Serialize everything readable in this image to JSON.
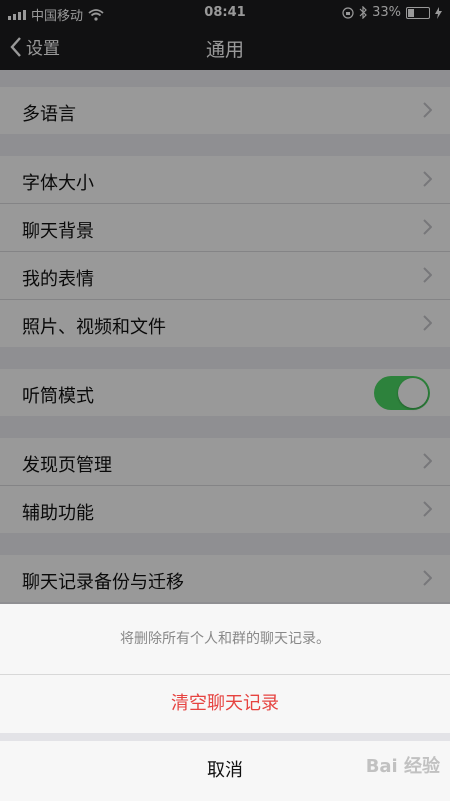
{
  "status_bar": {
    "carrier": "中国移动",
    "time": "08:41",
    "battery": "33%",
    "battery_level": 0.33
  },
  "nav": {
    "back_label": "设置",
    "title": "通用"
  },
  "settings": {
    "group1": [
      "多语言"
    ],
    "group2": [
      "字体大小",
      "聊天背景",
      "我的表情",
      "照片、视频和文件"
    ],
    "listen_mode": {
      "label": "听筒模式",
      "on": true
    },
    "group4": [
      "发现页管理",
      "辅助功能"
    ],
    "group5": [
      "聊天记录备份与迁移"
    ]
  },
  "action_sheet": {
    "message": "将删除所有个人和群的聊天记录。",
    "confirm": "清空聊天记录",
    "cancel": "取消"
  },
  "watermark": "Bai 经验",
  "colors": {
    "toggle_on": "#4cd964",
    "danger": "#e64340"
  }
}
